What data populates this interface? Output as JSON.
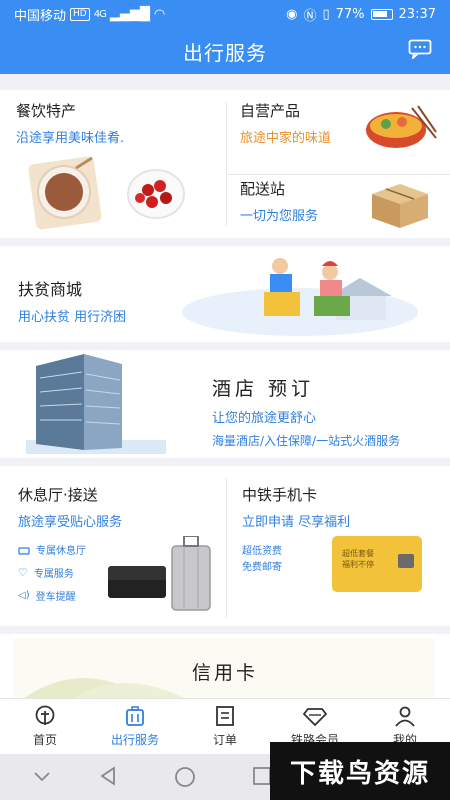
{
  "status": {
    "carrier": "中国移动",
    "hd": "HD",
    "network": "4G",
    "battery": "77%",
    "time": "23:37"
  },
  "header": {
    "title": "出行服务"
  },
  "catering": {
    "title": "餐饮特产",
    "subtitle": "沿途享用美味佳肴."
  },
  "self_products": {
    "title": "自营产品",
    "subtitle": "旅途中家的味道"
  },
  "delivery": {
    "title": "配送站",
    "subtitle": "一切为您服务"
  },
  "poverty_mall": {
    "title": "扶贫商城",
    "subtitle": "用心扶贫 用行济困"
  },
  "hotel": {
    "title": "酒店 预订",
    "subtitle": "让您的旅途更舒心",
    "desc": "海量酒店/入住保障/一站式火酒服务"
  },
  "lounge": {
    "title": "休息厅·接送",
    "subtitle": "旅途享受贴心服务",
    "features": [
      "专属休息厅",
      "专属服务",
      "登车提醒"
    ]
  },
  "sim_card": {
    "title": "中铁手机卡",
    "subtitle": "立即申请  尽享福利",
    "promo1": "超低资费",
    "promo2": "免费邮寄",
    "card_text1": "超低套餐",
    "card_text2": "福利不停"
  },
  "credit_card": {
    "title": "信用卡"
  },
  "nav": {
    "items": [
      {
        "label": "首页",
        "icon": "home-train-icon"
      },
      {
        "label": "出行服务",
        "icon": "luggage-icon"
      },
      {
        "label": "订单",
        "icon": "order-list-icon"
      },
      {
        "label": "铁路会员",
        "icon": "diamond-icon"
      },
      {
        "label": "我的",
        "icon": "person-icon"
      }
    ],
    "active_color": "#2f7fe0"
  },
  "watermark": "下载鸟资源",
  "colors": {
    "brand_blue": "#3a8df2",
    "accent_orange": "#e8912c"
  }
}
